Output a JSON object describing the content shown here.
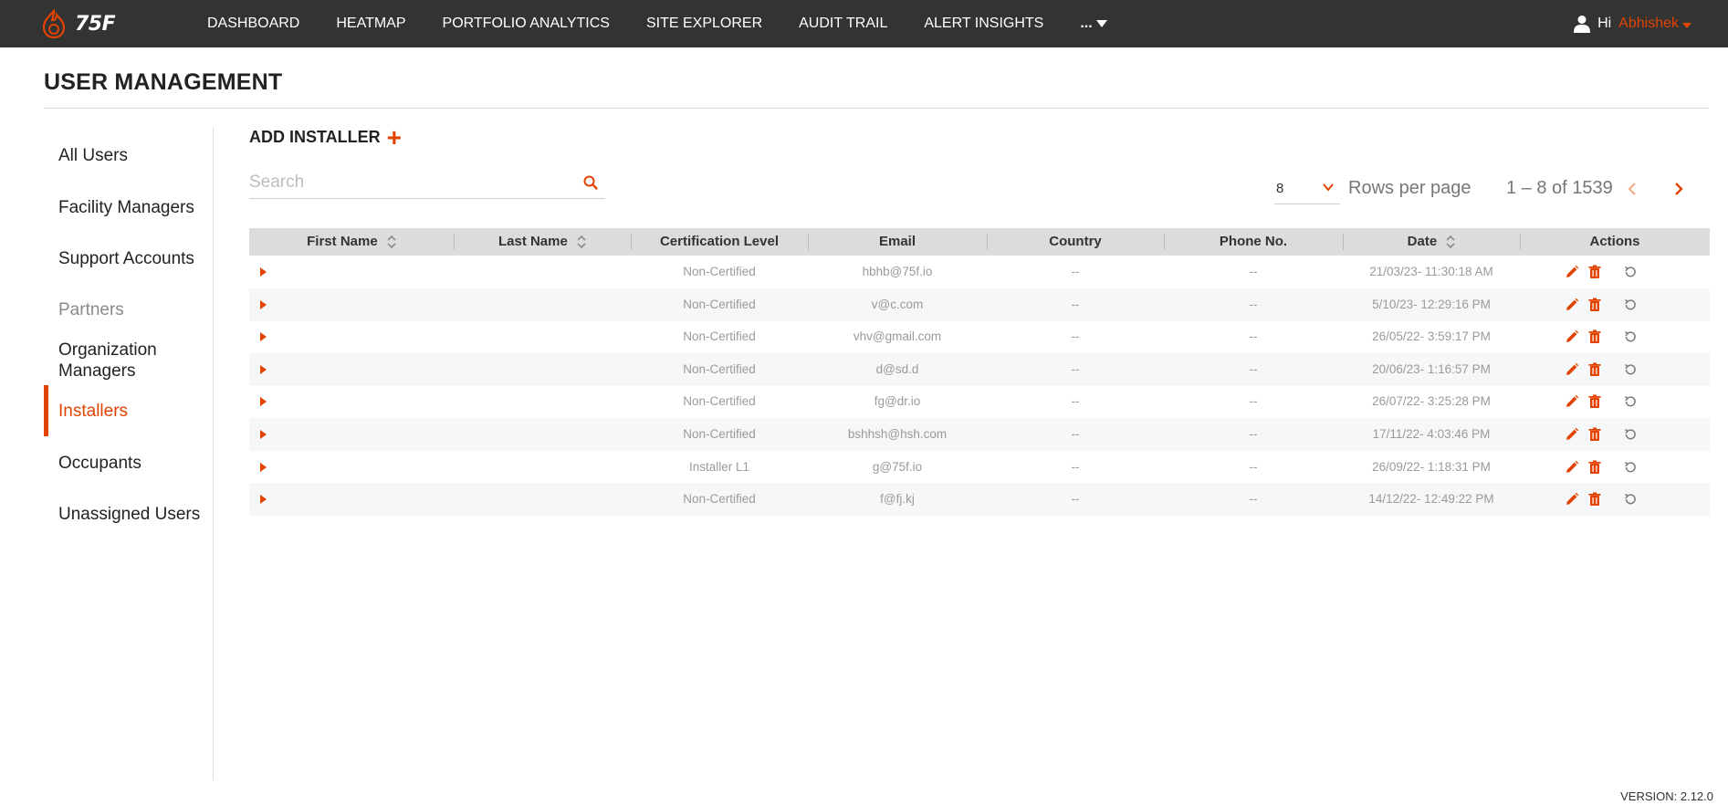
{
  "app": {
    "logo_text": "75F",
    "brand_color": "#e24301"
  },
  "nav": {
    "items": [
      "DASHBOARD",
      "HEATMAP",
      "PORTFOLIO ANALYTICS",
      "SITE EXPLORER",
      "AUDIT TRAIL",
      "ALERT INSIGHTS"
    ],
    "more_label": "..."
  },
  "user": {
    "greeting": "Hi",
    "name": "Abhishek"
  },
  "page": {
    "title": "USER MANAGEMENT"
  },
  "sidebar": {
    "items": [
      {
        "label": "All Users"
      },
      {
        "label": "Facility Managers"
      },
      {
        "label": "Support Accounts"
      },
      {
        "label": "Partners"
      },
      {
        "label": "Organization Managers"
      },
      {
        "label": "Installers"
      },
      {
        "label": "Occupants"
      },
      {
        "label": "Unassigned Users"
      }
    ],
    "active": "Installers"
  },
  "toolbar": {
    "add_label": "ADD INSTALLER",
    "add_icon": "+",
    "search_placeholder": "Search",
    "rows_per_page_value": "8",
    "rows_per_page_label": "Rows per page",
    "range_label": "1 – 8 of 1539"
  },
  "table": {
    "columns": [
      "First Name",
      "Last Name",
      "Certification Level",
      "Email",
      "Country",
      "Phone No.",
      "Date",
      "Actions"
    ],
    "rows": [
      {
        "first": "",
        "last": "",
        "cert": "Non-Certified",
        "email": "hbhb@75f.io",
        "country": "--",
        "phone": "--",
        "date": "21/03/23- 11:30:18 AM"
      },
      {
        "first": "",
        "last": "",
        "cert": "Non-Certified",
        "email": "v@c.com",
        "country": "--",
        "phone": "--",
        "date": "5/10/23- 12:29:16 PM"
      },
      {
        "first": "",
        "last": "",
        "cert": "Non-Certified",
        "email": "vhv@gmail.com",
        "country": "--",
        "phone": "--",
        "date": "26/05/22- 3:59:17 PM"
      },
      {
        "first": "",
        "last": "",
        "cert": "Non-Certified",
        "email": "d@sd.d",
        "country": "--",
        "phone": "--",
        "date": "20/06/23- 1:16:57 PM"
      },
      {
        "first": "",
        "last": "",
        "cert": "Non-Certified",
        "email": "fg@dr.io",
        "country": "--",
        "phone": "--",
        "date": "26/07/22- 3:25:28 PM"
      },
      {
        "first": "",
        "last": "",
        "cert": "Non-Certified",
        "email": "bshhsh@hsh.com",
        "country": "--",
        "phone": "--",
        "date": "17/11/22- 4:03:46 PM"
      },
      {
        "first": "",
        "last": "",
        "cert": "Installer L1",
        "email": "g@75f.io",
        "country": "--",
        "phone": "--",
        "date": "26/09/22- 1:18:31 PM"
      },
      {
        "first": "",
        "last": "",
        "cert": "Non-Certified",
        "email": "f@fj.kj",
        "country": "--",
        "phone": "--",
        "date": "14/12/22- 12:49:22 PM"
      }
    ]
  },
  "footer": {
    "version": "VERSION: 2.12.0"
  }
}
